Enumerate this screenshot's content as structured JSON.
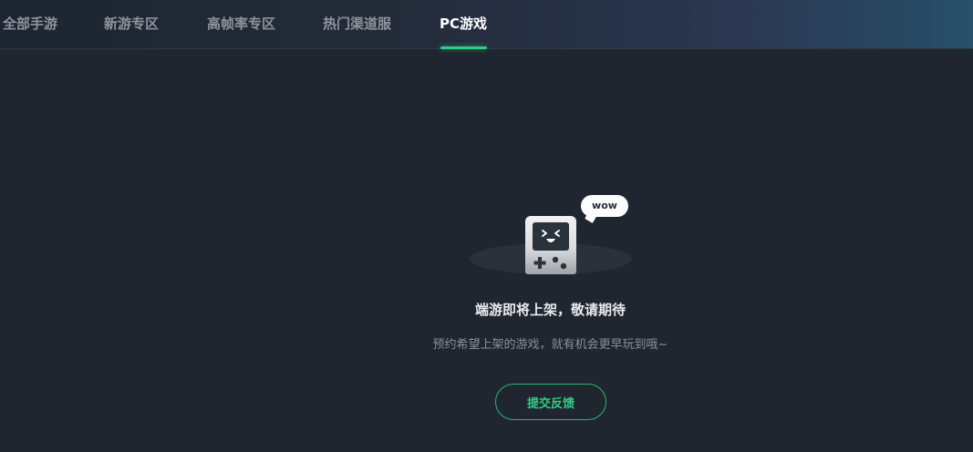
{
  "tabs": [
    {
      "label": "全部手游"
    },
    {
      "label": "新游专区"
    },
    {
      "label": "高帧率专区"
    },
    {
      "label": "热门渠道服"
    },
    {
      "label": "PC游戏",
      "active": true
    }
  ],
  "empty_state": {
    "bubble_text": "wow",
    "icon": "handheld-console-icon",
    "title": "端游即将上架，敬请期待",
    "description": "预约希望上架的游戏，就有机会更早玩到哦~",
    "button_label": "提交反馈"
  },
  "colors": {
    "accent": "#2fcf82",
    "background": "#20262f",
    "tab_inactive": "#8e949c",
    "tab_active": "#ffffff"
  }
}
